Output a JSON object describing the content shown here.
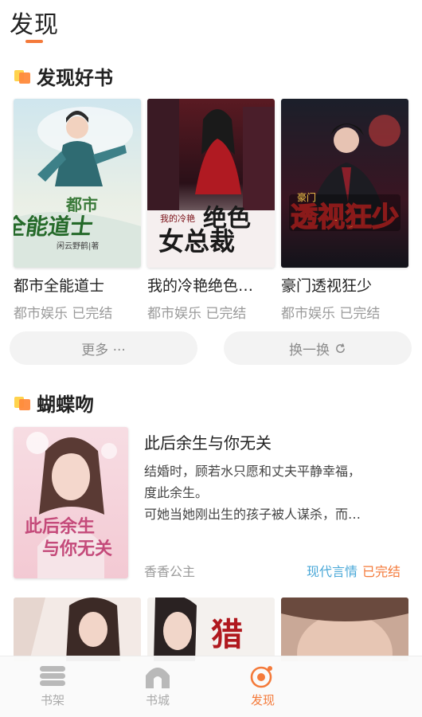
{
  "page": {
    "title": "发现"
  },
  "colors": {
    "accent": "#f47a3a",
    "category": "#4aa8d8",
    "meta": "#9a9a9a"
  },
  "section1": {
    "title": "发现好书",
    "icon": "section-squares-icon",
    "books": [
      {
        "title": "都市全能道士",
        "meta": "都市娱乐 已完结"
      },
      {
        "title": "我的冷艳绝色…",
        "meta": "都市娱乐 已完结"
      },
      {
        "title": "豪门透视狂少",
        "meta": "都市娱乐 已完结"
      }
    ],
    "more_label": "更多 ···",
    "swap_label": "换一换"
  },
  "section2": {
    "title": "蝴蝶吻",
    "icon": "section-squares-icon",
    "feature": {
      "title": "此后余生与你无关",
      "desc_lines": [
        "结婚时，顾若水只愿和丈夫平静幸福，",
        "度此余生。",
        "可她当她刚出生的孩子被人谋杀，而…"
      ],
      "author": "香香公主",
      "category": "现代言情",
      "status": "已完结"
    }
  },
  "tabbar": {
    "tabs": [
      {
        "label": "书架",
        "icon": "bookshelf-icon",
        "active": false
      },
      {
        "label": "书城",
        "icon": "bookstore-icon",
        "active": false
      },
      {
        "label": "发现",
        "icon": "discover-icon",
        "active": true
      }
    ]
  }
}
